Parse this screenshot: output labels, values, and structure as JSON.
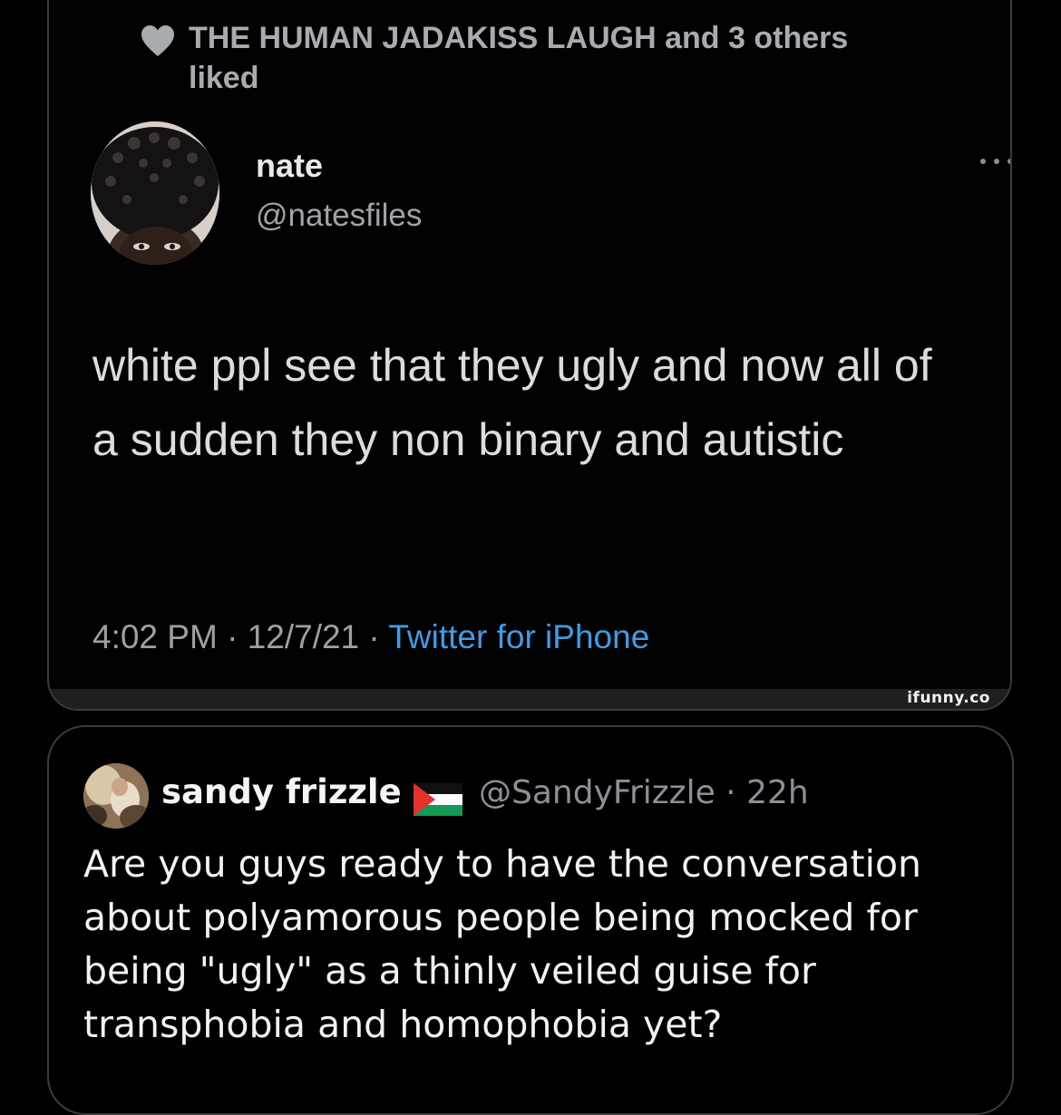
{
  "quoted_tweet": {
    "social_context": "THE HUMAN JADAKISS LAUGH and 3 others liked",
    "author": {
      "name": "nate",
      "handle": "@natesfiles"
    },
    "text": "white ppl see that they ugly and now all of a sudden they non binary and autistic",
    "time": "4:02 PM",
    "date": "12/7/21",
    "separator": " · ",
    "source": "Twitter for iPhone",
    "icons": [
      "heart-icon",
      "more-icon",
      "avatar"
    ],
    "watermark": "ifunny.co"
  },
  "reply_tweet": {
    "author": {
      "name": "sandy frizzle",
      "flag": "palestine-flag-icon",
      "handle": "@SandyFrizzle",
      "age": "22h"
    },
    "text": "Are you guys ready to have the conversation about polyamorous people being mocked for being \"ugly\" as a thinly veiled guise for transphobia and homophobia yet?"
  },
  "colors": {
    "background": "#000000",
    "link_blue": "#3f9ce6",
    "muted_text": "#9da1a5",
    "border": "#3a3b3d"
  }
}
